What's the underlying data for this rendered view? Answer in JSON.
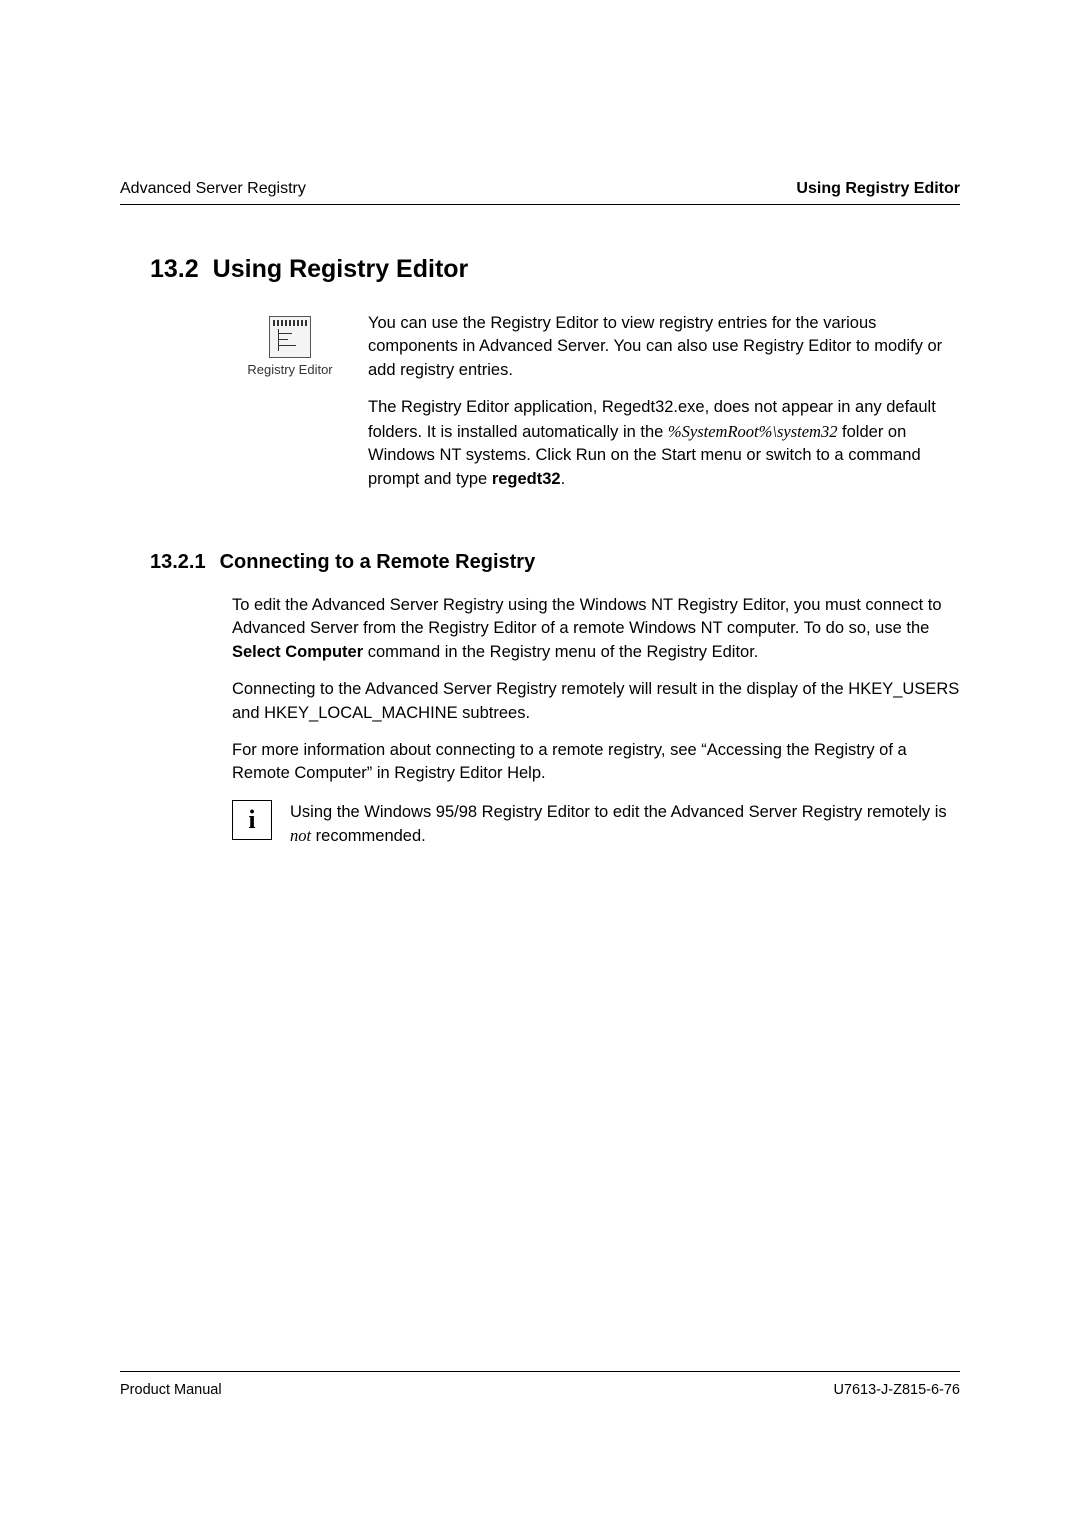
{
  "header": {
    "left": "Advanced Server Registry",
    "right": "Using Registry Editor"
  },
  "section": {
    "number": "13.2",
    "title": "Using Registry Editor"
  },
  "icon": {
    "caption": "Registry Editor"
  },
  "intro": {
    "p1": "You can use the Registry Editor to view registry entries for the various components in Advanced Server. You can also use Registry Editor to modify or add registry entries.",
    "p2_a": "The Registry Editor application, Regedt32.exe, does not appear in any default folders. It is installed automatically in the ",
    "p2_path": "%SystemRoot%\\system32",
    "p2_b": " folder on Windows NT systems. Click Run on the Start menu or switch to a command prompt and type ",
    "p2_cmd": "regedt32",
    "p2_c": "."
  },
  "subsection": {
    "number": "13.2.1",
    "title": "Connecting to a Remote Registry"
  },
  "body": {
    "p1_a": "To edit the Advanced Server Registry using the Windows NT Registry Editor, you must connect to Advanced Server from the Registry Editor of a remote Windows NT computer. To do so, use the ",
    "p1_bold": "Select Computer",
    "p1_b": " command in the Registry menu of the Registry Editor.",
    "p2": "Connecting to the Advanced Server Registry remotely will result in the display of  the HKEY_USERS and HKEY_LOCAL_MACHINE subtrees.",
    "p3": "For more information about connecting to a remote registry, see “Accessing the Registry of a Remote Computer” in Registry Editor Help."
  },
  "info": {
    "symbol": "i",
    "text_a": "Using the Windows 95/98 Registry Editor to edit the Advanced Server Registry remotely is ",
    "text_em": "not",
    "text_b": " recommended."
  },
  "footer": {
    "left": "Product Manual",
    "right": "U7613-J-Z815-6-76"
  }
}
